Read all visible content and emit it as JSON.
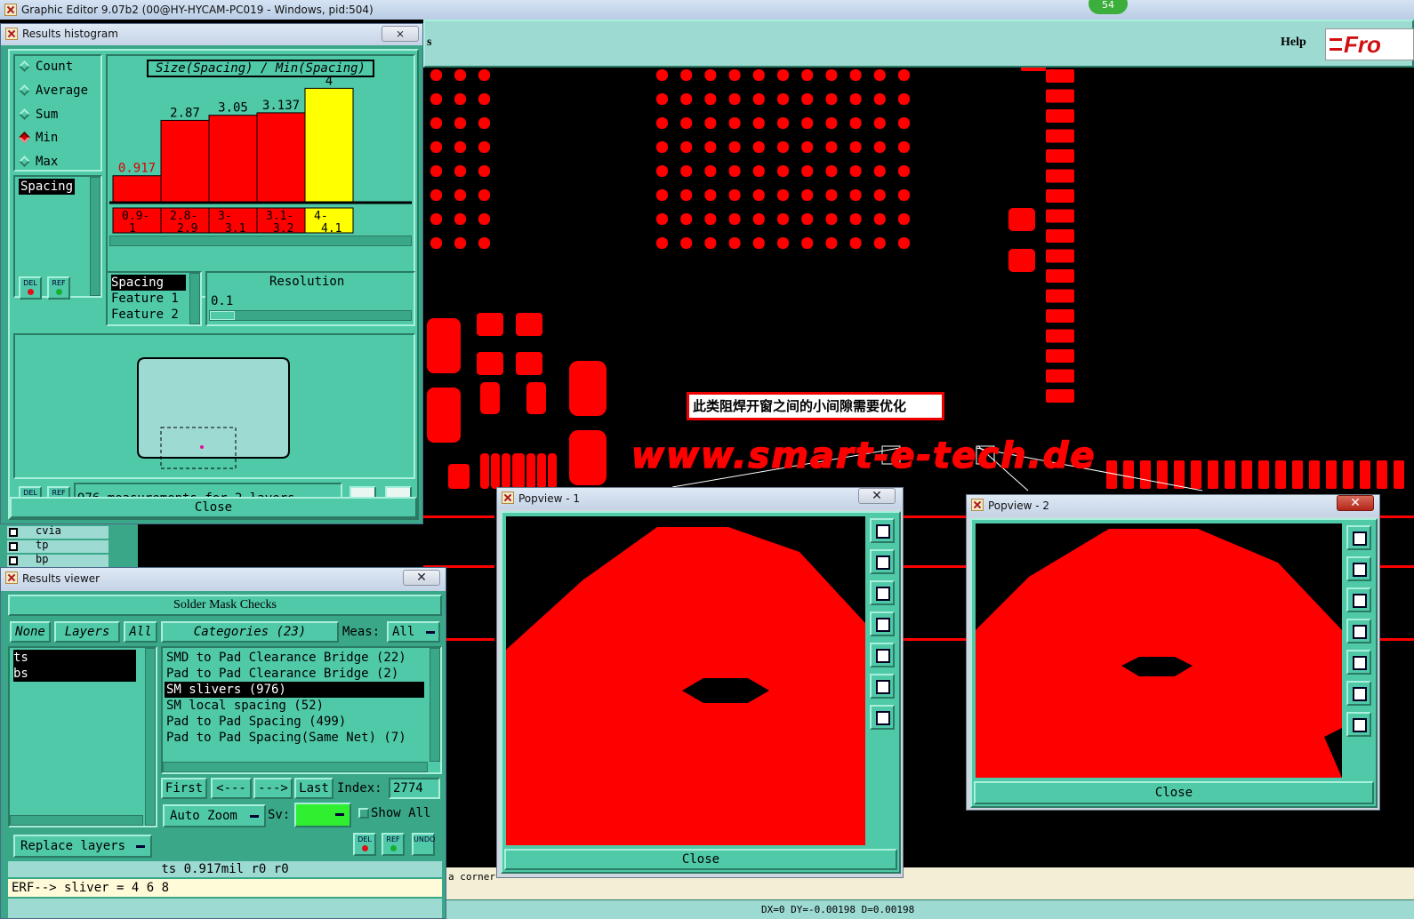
{
  "app": {
    "title": "Graphic Editor 9.07b2 (00@HY-HYCAM-PC019 - Windows, pid:504)",
    "help": "Help",
    "logo": "Fro",
    "badge": "54",
    "menu_fragment": "s"
  },
  "annotation": {
    "text": "此类阻焊开窗之间的小间隙需要优化",
    "watermark": "www.smart-e-tech.de"
  },
  "histogram": {
    "title": "Results histogram",
    "close_x": "⨯",
    "chart_title": "Size(Spacing) / Min(Spacing)",
    "radio": [
      "Count",
      "Average",
      "Sum",
      "Min",
      "Max"
    ],
    "selected_radio": "Min",
    "list_selected": "Spacing",
    "feature_list": [
      "Spacing",
      "Feature 1",
      "Feature 2"
    ],
    "resolution_label": "Resolution",
    "resolution_value": "0.1",
    "del": "DEL",
    "ref": "REF",
    "status": "976 measurements for 2 layers",
    "close": "Close"
  },
  "chart_data": {
    "type": "bar",
    "title": "Size(Spacing) / Min(Spacing)",
    "categories": [
      "0.9-1",
      "2.8-2.9",
      "3-3.1",
      "3.1-3.2",
      "4-4.1"
    ],
    "values": [
      0.917,
      2.87,
      3.05,
      3.137,
      4
    ],
    "value_labels": [
      "0.917",
      "2.87",
      "3.05",
      "3.137",
      "4"
    ],
    "ylim": [
      0,
      4.2
    ],
    "highlight_index": 4,
    "colors": {
      "bar": "#ff0000",
      "highlight": "#ffff00"
    }
  },
  "layers_strip": [
    "cvia",
    "tp",
    "bp"
  ],
  "viewer": {
    "title": "Results viewer",
    "heading": "Solder Mask Checks",
    "none": "None",
    "layers": "Layers",
    "all": "All",
    "categories": "Categories (23)",
    "meas_label": "Meas:",
    "meas_value": "All",
    "layer_items": [
      "ts",
      "bs"
    ],
    "category_items": [
      "SMD to Pad Clearance Bridge (22)",
      "Pad to Pad Clearance Bridge (2)",
      "SM slivers (976)",
      "SM local spacing (52)",
      "Pad to Pad Spacing (499)",
      "Pad to Pad Spacing(Same Net) (7)"
    ],
    "selected_category": "SM slivers (976)",
    "first": "First",
    "prev": "<---",
    "next": "--->",
    "last": "Last",
    "index_label": "Index:",
    "index_value": "2774",
    "zoom": "Auto Zoom",
    "sv": "Sv:",
    "show_all": "Show All",
    "replace": "Replace layers",
    "undo": "UNDO",
    "status": "ts 0.917mil  r0  r0",
    "erf": "ERF--> sliver = 4 6 8"
  },
  "popview1": {
    "title": "Popview - 1",
    "close": "Close"
  },
  "popview2": {
    "title": "Popview - 2",
    "close": "Close"
  },
  "bottom": {
    "corner": "a corner",
    "coords": "DX=0 DY=-0.00198 D=0.00198"
  },
  "colors": {
    "motif": "#4fc9a8",
    "pad": "#ff0000",
    "highlight": "#ffff00",
    "background": "#000000"
  }
}
